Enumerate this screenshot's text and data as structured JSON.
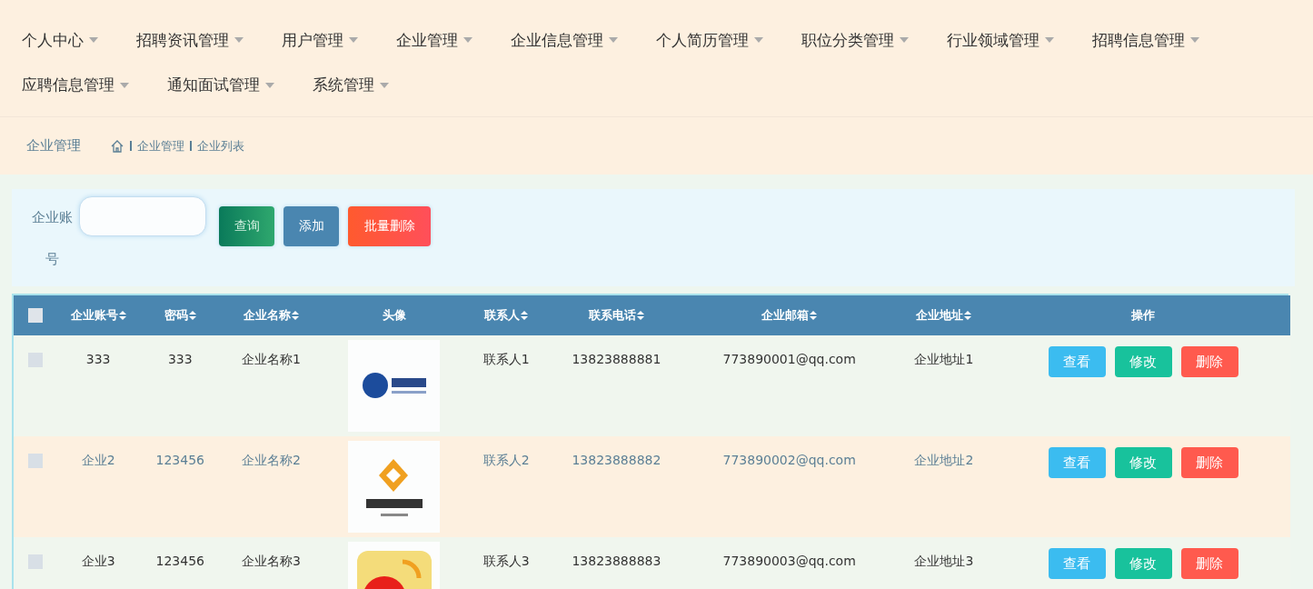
{
  "nav": {
    "items": [
      {
        "label": "个人中心"
      },
      {
        "label": "招聘资讯管理"
      },
      {
        "label": "用户管理"
      },
      {
        "label": "企业管理"
      },
      {
        "label": "企业信息管理"
      },
      {
        "label": "个人简历管理"
      },
      {
        "label": "职位分类管理"
      },
      {
        "label": "行业领域管理"
      },
      {
        "label": "招聘信息管理"
      },
      {
        "label": "应聘信息管理"
      },
      {
        "label": "通知面试管理"
      },
      {
        "label": "系统管理"
      }
    ]
  },
  "breadcrumb": {
    "title": "企业管理",
    "path": [
      "企业管理",
      "企业列表"
    ]
  },
  "search": {
    "label": "企业账号",
    "buttons": [
      {
        "label": "查询",
        "kind": "search"
      },
      {
        "label": "添加",
        "kind": "add"
      },
      {
        "label": "批量删除",
        "kind": "bulk-delete"
      }
    ]
  },
  "table": {
    "select_all": {
      "checked": false
    },
    "columns": [
      {
        "label": "企业账号",
        "sortable": true
      },
      {
        "label": "密码",
        "sortable": true
      },
      {
        "label": "企业名称",
        "sortable": true
      },
      {
        "label": "头像",
        "sortable": false
      },
      {
        "label": "联系人",
        "sortable": true
      },
      {
        "label": "联系电话",
        "sortable": true
      },
      {
        "label": "企业邮箱",
        "sortable": true
      },
      {
        "label": "企业地址",
        "sortable": true
      },
      {
        "label": "操作",
        "sortable": false
      }
    ],
    "rows": [
      {
        "checked": false,
        "hovered": false,
        "cells": [
          "333",
          "333",
          "企业名称1",
          {
            "kind": "picture"
          },
          "联系人1",
          "13823888881",
          "773890001@qq.com",
          "企业地址1"
        ],
        "actions": [
          {
            "label": "查看",
            "kind": "view"
          },
          {
            "label": "修改",
            "kind": "edit"
          },
          {
            "label": "删除",
            "kind": "delete"
          }
        ]
      },
      {
        "checked": false,
        "hovered": true,
        "cells": [
          "企业2",
          "123456",
          "企业名称2",
          {
            "kind": "picture"
          },
          "联系人2",
          "13823888882",
          "773890002@qq.com",
          "企业地址2"
        ],
        "actions": [
          {
            "label": "查看",
            "kind": "view"
          },
          {
            "label": "修改",
            "kind": "edit"
          },
          {
            "label": "删除",
            "kind": "delete"
          }
        ]
      },
      {
        "checked": false,
        "hovered": false,
        "cells": [
          "企业3",
          "123456",
          "企业名称3",
          {
            "kind": "picture"
          },
          "联系人3",
          "13823888883",
          "773890003@qq.com",
          "企业地址3"
        ],
        "actions": [
          {
            "label": "查看",
            "kind": "view"
          },
          {
            "label": "修改",
            "kind": "edit"
          },
          {
            "label": "删除",
            "kind": "delete"
          }
        ]
      }
    ]
  }
}
